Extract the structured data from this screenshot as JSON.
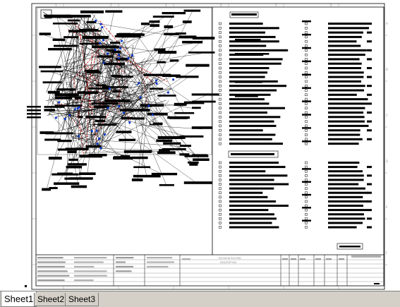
{
  "app": {
    "view": "worksheet",
    "content": "electrical schematic drawing sheet"
  },
  "sheet_tabs": [
    {
      "label": "Sheet1",
      "active": true
    },
    {
      "label": "Sheet2",
      "active": false
    },
    {
      "label": "Sheet3",
      "active": false
    }
  ],
  "border": {
    "top_numbers": [
      "1",
      "2",
      "3",
      "4",
      "5",
      "6",
      "7",
      "8",
      "9",
      "10"
    ],
    "side_letters": [
      "A",
      "B",
      "C",
      "D",
      "E",
      "F"
    ]
  },
  "schematic": {
    "wire_colors": {
      "signal": "#000000",
      "highlight": "#cc0000",
      "junction": "#0033cc"
    },
    "component_label_count": 150,
    "leader_line_count": 140
  },
  "parts_list": {
    "upper_rows": 28,
    "lower_rows": 16,
    "header_label_box": "",
    "mid_label_box": ""
  },
  "title_block": {
    "revisions_header": "REVISION RECORD",
    "description_header": "DESCRIPTION",
    "rows": [
      "",
      "",
      "",
      "",
      "",
      ""
    ],
    "colors": {
      "line": "#000000",
      "faint_text": "#8a8a8a"
    }
  }
}
